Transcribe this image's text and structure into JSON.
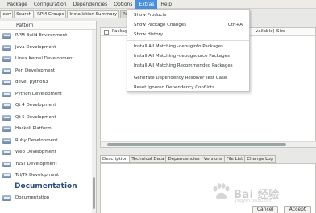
{
  "menubar": {
    "items": [
      "Package",
      "Configuration",
      "Dependencies",
      "Options",
      "Extras",
      "Help"
    ],
    "active": "Extras"
  },
  "toolbar": {
    "view_value": "iew",
    "search_label": "Search",
    "rpm_groups_label": "RPM Groups",
    "install_summary_label": "Installation Summary",
    "patterns_label": "Patte"
  },
  "left_pane": {
    "header": "Pattern",
    "items": [
      "RPM Build Environment",
      "Java Development",
      "Linux Kernel Development",
      "Perl Development",
      "devel_python3",
      "Python Development",
      "Qt 4 Development",
      "Qt 5 Development",
      "Haskell Platform",
      "Ruby Development",
      "Web Development",
      "YaST Development",
      "Tcl/Tk Development"
    ],
    "category": "Documentation",
    "last_item": "Documentation"
  },
  "package_list": {
    "col_package": "Packag",
    "col_tail": "vailable)",
    "col_size": "Size"
  },
  "detail_tabs": [
    "Description",
    "Technical Data",
    "Dependencies",
    "Versions",
    "File List",
    "Change Log"
  ],
  "buttons": {
    "cancel": "Cancel",
    "accept": "Accept"
  },
  "extras_menu": {
    "items": [
      {
        "label": "Show Products",
        "accel": ""
      },
      {
        "label": "Show Package Changes",
        "accel": "Ctrl+A"
      },
      {
        "label": "Show History",
        "accel": ""
      },
      {
        "label": "Install All Matching -debuginfo Packages",
        "accel": ""
      },
      {
        "label": "Install All Matching -debugsource Packages",
        "accel": ""
      },
      {
        "label": "Install All Matching Recommended Packages",
        "accel": ""
      },
      {
        "label": "Generate Dependency Resolver Test Case",
        "accel": ""
      },
      {
        "label": "Reset Ignored Dependency Conflicts",
        "accel": ""
      }
    ]
  },
  "colors": {
    "accent": "#4a90d9",
    "category_text": "#2a4d7a"
  },
  "watermark": {
    "brand": "Bai 经验",
    "sub": "jingyan.baidu.com"
  }
}
